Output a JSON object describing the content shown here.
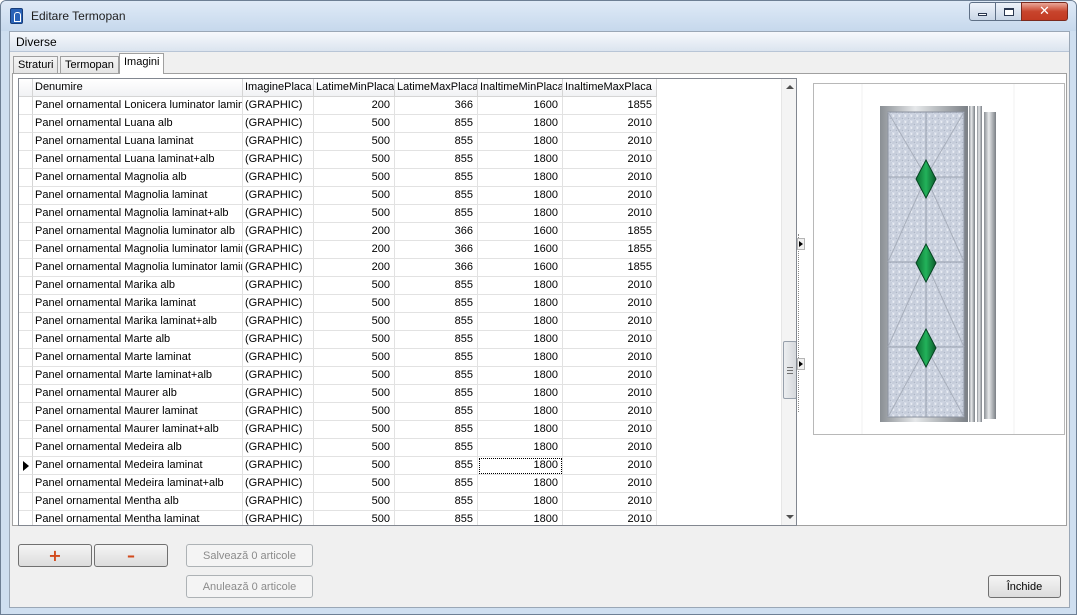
{
  "window": {
    "title": "Editare Termopan"
  },
  "menu": {
    "items": [
      "Diverse"
    ]
  },
  "tabs": [
    {
      "label": "Straturi",
      "active": false
    },
    {
      "label": "Termopan",
      "active": false
    },
    {
      "label": "Imagini",
      "active": true
    }
  ],
  "grid": {
    "columns": [
      "Denumire",
      "ImaginePlaca",
      "LatimeMinPlaca",
      "LatimeMaxPlaca",
      "InaltimeMinPlaca",
      "InaltimeMaxPlaca"
    ],
    "current_row": 20,
    "rows": [
      [
        "Panel ornamental Lonicera luminator laminat",
        "(GRAPHIC)",
        "200",
        "366",
        "1600",
        "1855"
      ],
      [
        "Panel ornamental Luana alb",
        "(GRAPHIC)",
        "500",
        "855",
        "1800",
        "2010"
      ],
      [
        "Panel ornamental Luana laminat",
        "(GRAPHIC)",
        "500",
        "855",
        "1800",
        "2010"
      ],
      [
        "Panel ornamental Luana laminat+alb",
        "(GRAPHIC)",
        "500",
        "855",
        "1800",
        "2010"
      ],
      [
        "Panel ornamental Magnolia alb",
        "(GRAPHIC)",
        "500",
        "855",
        "1800",
        "2010"
      ],
      [
        "Panel ornamental Magnolia laminat",
        "(GRAPHIC)",
        "500",
        "855",
        "1800",
        "2010"
      ],
      [
        "Panel ornamental Magnolia laminat+alb",
        "(GRAPHIC)",
        "500",
        "855",
        "1800",
        "2010"
      ],
      [
        "Panel ornamental Magnolia luminator alb",
        "(GRAPHIC)",
        "200",
        "366",
        "1600",
        "1855"
      ],
      [
        "Panel ornamental Magnolia luminator laminat",
        "(GRAPHIC)",
        "200",
        "366",
        "1600",
        "1855"
      ],
      [
        "Panel ornamental Magnolia luminator laminat",
        "(GRAPHIC)",
        "200",
        "366",
        "1600",
        "1855"
      ],
      [
        "Panel ornamental Marika alb",
        "(GRAPHIC)",
        "500",
        "855",
        "1800",
        "2010"
      ],
      [
        "Panel ornamental Marika laminat",
        "(GRAPHIC)",
        "500",
        "855",
        "1800",
        "2010"
      ],
      [
        "Panel ornamental Marika laminat+alb",
        "(GRAPHIC)",
        "500",
        "855",
        "1800",
        "2010"
      ],
      [
        "Panel ornamental Marte alb",
        "(GRAPHIC)",
        "500",
        "855",
        "1800",
        "2010"
      ],
      [
        "Panel ornamental Marte laminat",
        "(GRAPHIC)",
        "500",
        "855",
        "1800",
        "2010"
      ],
      [
        "Panel ornamental Marte laminat+alb",
        "(GRAPHIC)",
        "500",
        "855",
        "1800",
        "2010"
      ],
      [
        "Panel ornamental Maurer alb",
        "(GRAPHIC)",
        "500",
        "855",
        "1800",
        "2010"
      ],
      [
        "Panel ornamental Maurer laminat",
        "(GRAPHIC)",
        "500",
        "855",
        "1800",
        "2010"
      ],
      [
        "Panel ornamental Maurer laminat+alb",
        "(GRAPHIC)",
        "500",
        "855",
        "1800",
        "2010"
      ],
      [
        "Panel ornamental Medeira alb",
        "(GRAPHIC)",
        "500",
        "855",
        "1800",
        "2010"
      ],
      [
        "Panel ornamental Medeira laminat",
        "(GRAPHIC)",
        "500",
        "855",
        "1800",
        "2010"
      ],
      [
        "Panel ornamental Medeira laminat+alb",
        "(GRAPHIC)",
        "500",
        "855",
        "1800",
        "2010"
      ],
      [
        "Panel ornamental Mentha alb",
        "(GRAPHIC)",
        "500",
        "855",
        "1800",
        "2010"
      ],
      [
        "Panel ornamental Mentha laminat",
        "(GRAPHIC)",
        "500",
        "855",
        "1800",
        "2010"
      ]
    ]
  },
  "buttons": {
    "add_icon": "plus-icon",
    "remove_icon": "minus-icon",
    "save_label": "Salvează 0 articole",
    "cancel_label": "Anulează 0 articole",
    "close_label": "Închide"
  },
  "preview": {
    "icon": "door-panel-image",
    "accent": "#1e9e4e"
  }
}
